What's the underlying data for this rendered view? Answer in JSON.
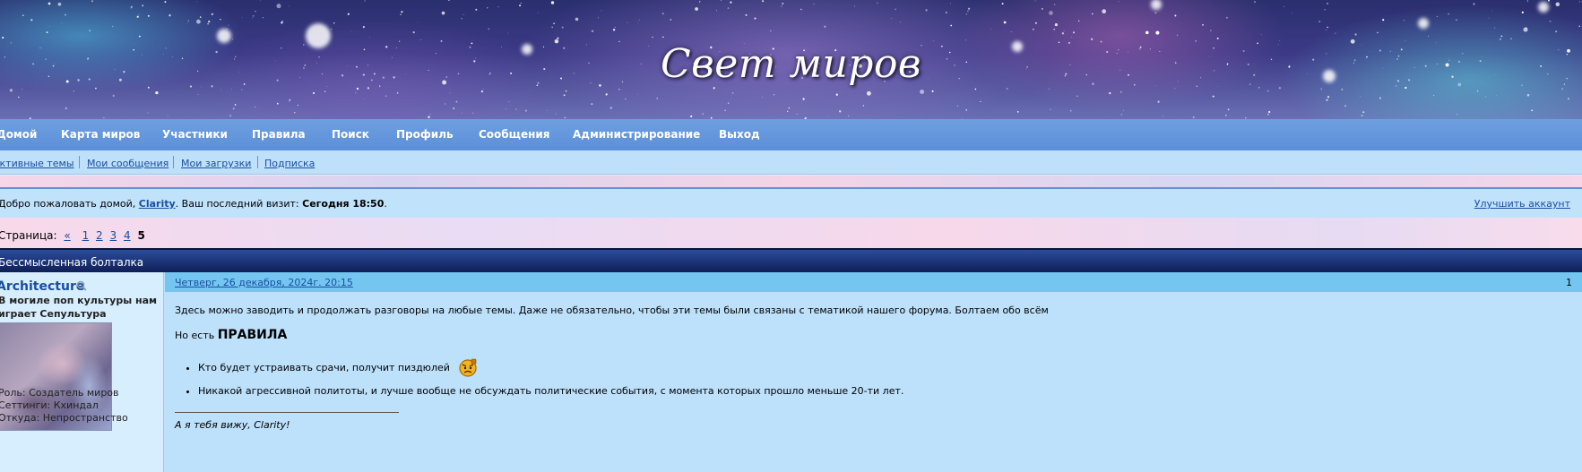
{
  "site": {
    "title": "Свет миров"
  },
  "mainnav": [
    {
      "label": "Домой"
    },
    {
      "label": "Карта миров"
    },
    {
      "label": "Участники"
    },
    {
      "label": "Правила"
    },
    {
      "label": "Поиск"
    },
    {
      "label": "Профиль"
    },
    {
      "label": "Сообщения"
    },
    {
      "label": "Администрирование"
    },
    {
      "label": "Выход"
    }
  ],
  "subnav": [
    {
      "label": "Активные темы"
    },
    {
      "label": "Мои сообщения"
    },
    {
      "label": "Мои загрузки"
    },
    {
      "label": "Подписка"
    }
  ],
  "welcome": {
    "prefix": "Добро пожаловать домой, ",
    "user": "Clarity",
    "mid": ". Ваш последний визит: ",
    "last_visit": "Сегодня 18:50",
    "suffix": ".",
    "upgrade": "Улучшить аккаунт"
  },
  "pager": {
    "label": "Страница:",
    "prev": "«",
    "pages": [
      "1",
      "2",
      "3",
      "4"
    ],
    "current": "5"
  },
  "thread": {
    "title": "Бессмысленная болталка"
  },
  "post": {
    "author": "Architecture",
    "author_status": [
      "В могиле поп культуры нам",
      "играет Сепультура"
    ],
    "meta": [
      "Роль: Создатель миров",
      "Сеттинги: Кхиндал",
      "Откуда: Непространство"
    ],
    "date": "Четверг, 26 декабря, 2024г. 20:15",
    "number": "1",
    "intro": "Здесь можно заводить и продолжать разговоры на любые темы. Даже не обязательно, чтобы эти темы были связаны с тематикой нашего форума. Болтаем обо всём",
    "rules_prefix": "Но есть ",
    "rules_word": "ПРАВИЛА",
    "rules": [
      "Кто будет устраивать срачи, получит пиздюлей",
      "Никакой агрессивной политоты, и лучше вообще не обсуждать политические события, с момента которых прошло меньше 20-ти лет."
    ],
    "signature": "А я тебя вижу, Clarity!"
  },
  "colors": {
    "nav_bg": "#6e9fe0",
    "subnav_bg": "#bfe0fa",
    "thread_head_bg": "#0f1e57",
    "post_head_bg": "#74c6f1",
    "post_bg": "#bde0fb",
    "link": "#1a4fa0"
  }
}
